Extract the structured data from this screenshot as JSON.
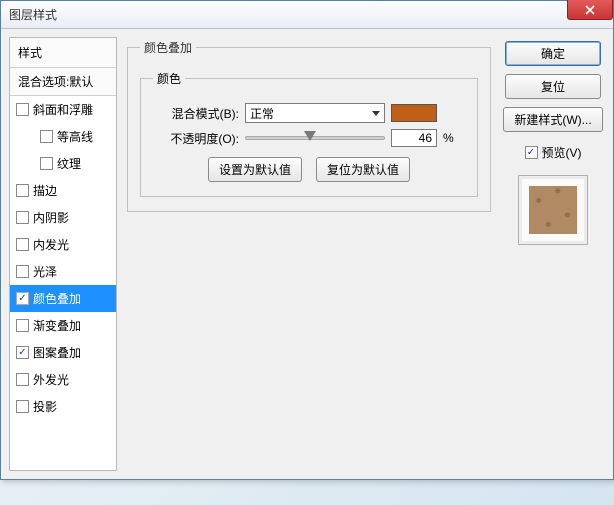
{
  "title": "图层样式",
  "sidebar": {
    "header": "样式",
    "sub": "混合选项:默认",
    "items": [
      {
        "label": "斜面和浮雕",
        "checked": false,
        "indent": false
      },
      {
        "label": "等高线",
        "checked": false,
        "indent": true
      },
      {
        "label": "纹理",
        "checked": false,
        "indent": true
      },
      {
        "label": "描边",
        "checked": false,
        "indent": false
      },
      {
        "label": "内阴影",
        "checked": false,
        "indent": false
      },
      {
        "label": "内发光",
        "checked": false,
        "indent": false
      },
      {
        "label": "光泽",
        "checked": false,
        "indent": false
      },
      {
        "label": "颜色叠加",
        "checked": true,
        "indent": false,
        "selected": true
      },
      {
        "label": "渐变叠加",
        "checked": false,
        "indent": false
      },
      {
        "label": "图案叠加",
        "checked": true,
        "indent": false
      },
      {
        "label": "外发光",
        "checked": false,
        "indent": false
      },
      {
        "label": "投影",
        "checked": false,
        "indent": false
      }
    ]
  },
  "group": {
    "title": "颜色叠加",
    "inner_title": "颜色",
    "blend_label": "混合模式(B):",
    "blend_value": "正常",
    "swatch_color": "#c06018",
    "opacity_label": "不透明度(O):",
    "opacity_value": "46",
    "opacity_suffix": "%",
    "default_btn": "设置为默认值",
    "reset_btn": "复位为默认值"
  },
  "right": {
    "ok": "确定",
    "cancel": "复位",
    "newstyle": "新建样式(W)...",
    "preview_label": "预览(V)",
    "preview_checked": true
  },
  "chart_data": null
}
